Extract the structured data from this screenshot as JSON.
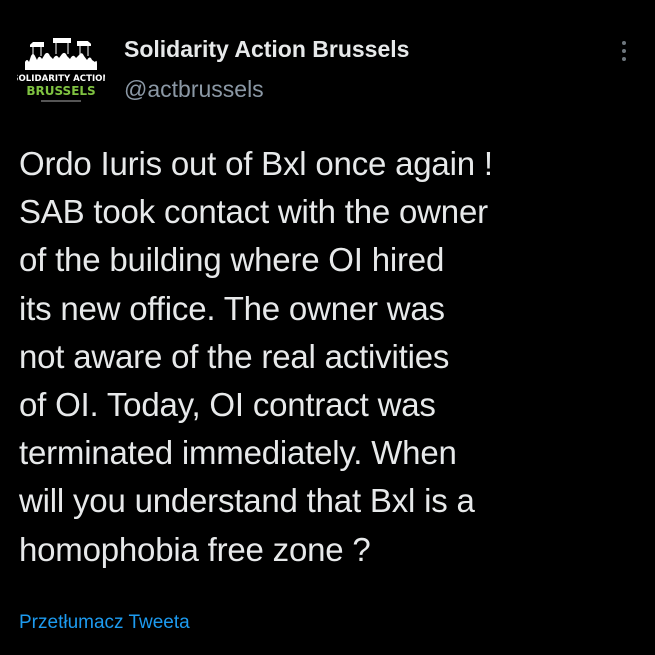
{
  "author": {
    "display_name": "Solidarity Action Brussels",
    "handle": "@actbrussels",
    "avatar": {
      "line1": "SOLIDARITY ACTION",
      "line2": "BRUSSELS",
      "icon": "protest-crowd-logo"
    }
  },
  "tweet": {
    "lines": [
      "Ordo Iuris out of Bxl once again !",
      "SAB took contact with the owner",
      "of the building where OI hired",
      "its new office. The owner was",
      "not aware of the real activities",
      "of OI. Today, OI contract was",
      "terminated immediately. When",
      "will you understand that Bxl is a",
      "homophobia free zone ?"
    ]
  },
  "translate_label": "Przetłumacz Tweeta",
  "colors": {
    "background": "#000000",
    "text": "#e7e9ea",
    "secondary": "#8b98a5",
    "link": "#1d9bf0",
    "logo_green": "#7fc241"
  }
}
